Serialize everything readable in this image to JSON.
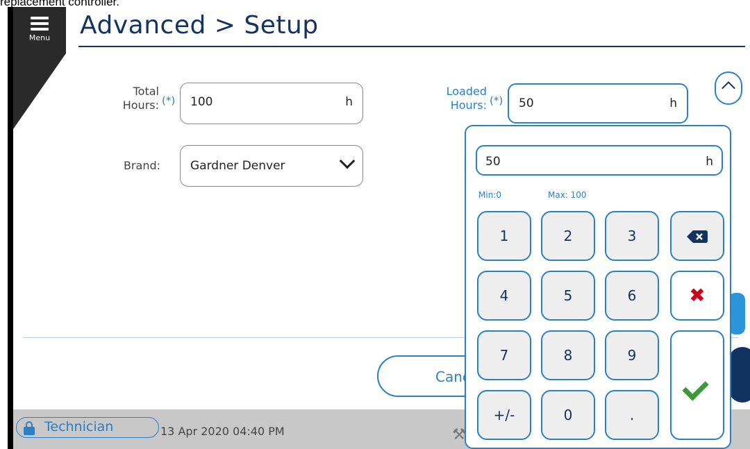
{
  "caption": "replacement controller.",
  "menu": {
    "label": "Menu"
  },
  "page": {
    "title": "Advanced > Setup"
  },
  "fields": {
    "total_hours": {
      "label_line1": "Total",
      "label_line2": "Hours:",
      "required": "(*)",
      "value": "100",
      "unit": "h"
    },
    "loaded_hours": {
      "label_line1": "Loaded",
      "label_line2": "Hours:",
      "required": "(*)",
      "value": "50",
      "unit": "h"
    },
    "brand": {
      "label": "Brand:",
      "value": "Gardner Denver"
    }
  },
  "keypad": {
    "display_value": "50",
    "unit": "h",
    "min_label": "Min:0",
    "max_label": "Max: 100",
    "keys": {
      "k1": "1",
      "k2": "2",
      "k3": "3",
      "k4": "4",
      "k5": "5",
      "k6": "6",
      "k7": "7",
      "k8": "8",
      "k9": "9",
      "k0": "0",
      "sign": "+/-",
      "dot": "."
    },
    "clear_symbol": "✖"
  },
  "footer": {
    "cancel_label": "Cancel"
  },
  "status": {
    "role": "Technician",
    "datetime": "13 Apr 2020  04:40 PM"
  },
  "colors": {
    "accent": "#2a7fc6",
    "title": "#12335f",
    "clear": "#d0021b",
    "confirm": "#3a9a3a"
  }
}
